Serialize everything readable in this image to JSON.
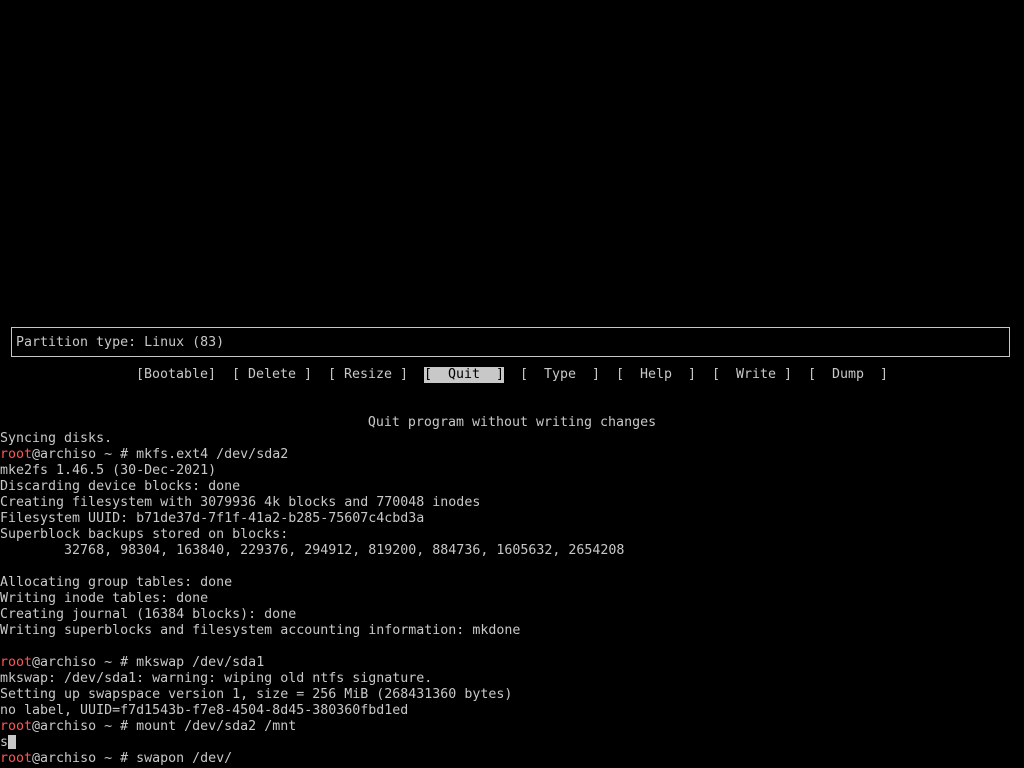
{
  "cfdisk": {
    "partition_info": "Partition type: Linux (83)",
    "menu": [
      {
        "label": "[Bootable]",
        "selected": false
      },
      {
        "label": "[ Delete ]",
        "selected": false
      },
      {
        "label": "[ Resize ]",
        "selected": false
      },
      {
        "label": "[  Quit  ]",
        "selected": true
      },
      {
        "label": "[  Type  ]",
        "selected": false
      },
      {
        "label": "[  Help  ]",
        "selected": false
      },
      {
        "label": "[  Write ]",
        "selected": false
      },
      {
        "label": "[  Dump  ]",
        "selected": false
      }
    ],
    "status": "Quit program without writing changes"
  },
  "terminal": {
    "prompt_user": "root",
    "prompt_rest": "@archiso ~ # ",
    "lines": [
      {
        "type": "output",
        "text": "Syncing disks."
      },
      {
        "type": "prompt",
        "cmd": "mkfs.ext4 /dev/sda2"
      },
      {
        "type": "output",
        "text": "mke2fs 1.46.5 (30-Dec-2021)"
      },
      {
        "type": "output",
        "text": "Discarding device blocks: done"
      },
      {
        "type": "output",
        "text": "Creating filesystem with 3079936 4k blocks and 770048 inodes"
      },
      {
        "type": "output",
        "text": "Filesystem UUID: b71de37d-7f1f-41a2-b285-75607c4cbd3a"
      },
      {
        "type": "output",
        "text": "Superblock backups stored on blocks:"
      },
      {
        "type": "output",
        "text": "        32768, 98304, 163840, 229376, 294912, 819200, 884736, 1605632, 2654208"
      },
      {
        "type": "output",
        "text": ""
      },
      {
        "type": "output",
        "text": "Allocating group tables: done"
      },
      {
        "type": "output",
        "text": "Writing inode tables: done"
      },
      {
        "type": "output",
        "text": "Creating journal (16384 blocks): done"
      },
      {
        "type": "output",
        "text": "Writing superblocks and filesystem accounting information: mkdone"
      },
      {
        "type": "output",
        "text": ""
      },
      {
        "type": "prompt",
        "cmd": "mkswap /dev/sda1"
      },
      {
        "type": "output",
        "text": "mkswap: /dev/sda1: warning: wiping old ntfs signature."
      },
      {
        "type": "output",
        "text": "Setting up swapspace version 1, size = 256 MiB (268431360 bytes)"
      },
      {
        "type": "output",
        "text": "no label, UUID=f7d1543b-f7e8-4504-8d45-380360fbd1ed"
      },
      {
        "type": "prompt",
        "cmd": "mount /dev/sda2 /mnt"
      },
      {
        "type": "input",
        "text": "s"
      },
      {
        "type": "prompt",
        "cmd": "swapon /dev/"
      }
    ]
  }
}
